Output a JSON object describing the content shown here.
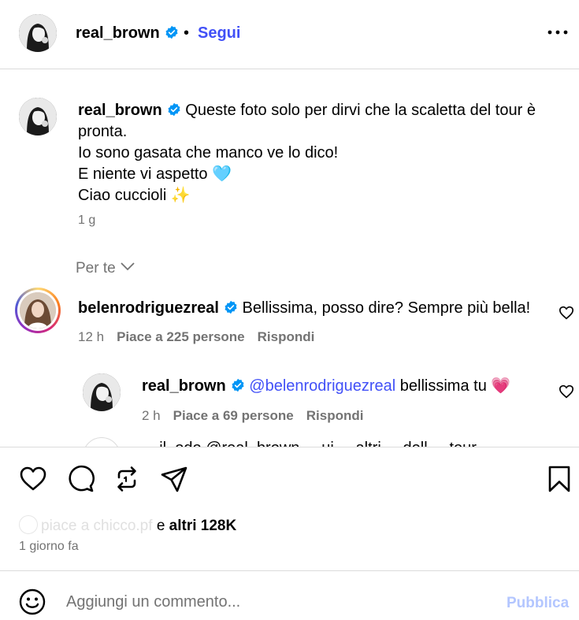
{
  "header": {
    "username": "real_brown",
    "separator": "•",
    "follow_label": "Segui",
    "more_icon": "more-horizontal-icon"
  },
  "caption": {
    "username": "real_brown",
    "line1": "Queste foto solo per dirvi che la scaletta del tour è pronta.",
    "line2": "Io sono gasata che manco ve lo dico!",
    "line3_text": "E niente vi aspetto ",
    "line3_emoji": "🩵",
    "line4_text": "Ciao cuccioli ",
    "line4_emoji": "✨",
    "time": "1 g"
  },
  "for_you_label": "Per te",
  "comments": [
    {
      "username": "belenrodriguezreal",
      "text": "Bellissima, posso dire? Sempre più bella!",
      "time": "12 h",
      "likes": "Piace a 225 persone",
      "reply_label": "Rispondi",
      "replies": [
        {
          "username": "real_brown",
          "mention": "@belenrodriguezreal",
          "text": " bellissima tu ",
          "emoji": "💗",
          "time": "2 h",
          "likes": "Piace a 69 persone",
          "reply_label": "Rispondi"
        }
      ]
    }
  ],
  "partial_comment": "...  il_odo  @real_brown ... ui ... altri ... dell ... tour ...",
  "actions": {
    "like_icon": "heart-icon",
    "comment_icon": "comment-icon",
    "repost_icon": "repost-icon",
    "share_icon": "send-icon",
    "save_icon": "bookmark-icon"
  },
  "likes_summary": {
    "faded_user": "piace a chicco.pf",
    "and_label": "e",
    "others": "altri 128K"
  },
  "post_date": "1 giorno fa",
  "add_comment": {
    "placeholder": "Aggiungi un commento...",
    "publish_label": "Pubblica",
    "emoji_icon": "smiley-icon"
  },
  "colors": {
    "accent": "#4150f7",
    "verified": "#0095f6",
    "secondary_text": "#737373",
    "publish_disabled": "#b3c6ff",
    "divider": "#dbdbdb"
  }
}
